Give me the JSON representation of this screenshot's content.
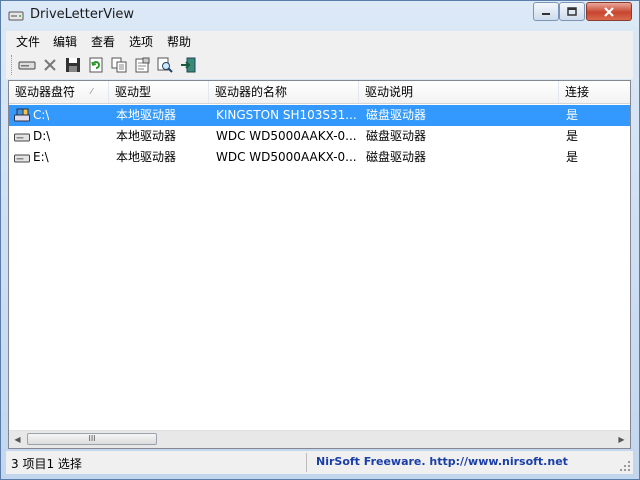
{
  "window": {
    "title": "DriveLetterView"
  },
  "menu": {
    "items": [
      "文件",
      "编辑",
      "查看",
      "选项",
      "帮助"
    ]
  },
  "toolbar": {
    "icons": [
      "drive-icon",
      "delete-icon",
      "save-icon",
      "refresh-icon",
      "copy-icon",
      "properties-icon",
      "find-icon",
      "exit-icon"
    ]
  },
  "list": {
    "columns": [
      "驱动器盘符",
      "驱动型",
      "驱动器的名称",
      "驱动说明",
      "连接"
    ],
    "rows": [
      {
        "letter": "C:\\",
        "type": "本地驱动器",
        "name": "KINGSTON SH103S31...",
        "desc": "磁盘驱动器",
        "connected": "是",
        "selected": true
      },
      {
        "letter": "D:\\",
        "type": "本地驱动器",
        "name": "WDC WD5000AAKX-0...",
        "desc": "磁盘驱动器",
        "connected": "是",
        "selected": false
      },
      {
        "letter": "E:\\",
        "type": "本地驱动器",
        "name": "WDC WD5000AAKX-0...",
        "desc": "磁盘驱动器",
        "connected": "是",
        "selected": false
      }
    ]
  },
  "scrollbar": {
    "thumb_label": "III"
  },
  "status": {
    "left": "3 项目1 选择",
    "link": "NirSoft Freeware.  http://www.nirsoft.net"
  },
  "colors": {
    "selection": "#3399ff",
    "link": "#1a3ea8",
    "close_button": "#c8452f"
  }
}
